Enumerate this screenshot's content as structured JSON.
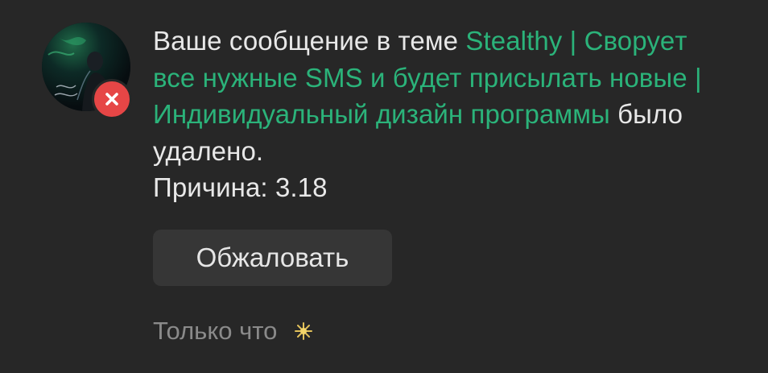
{
  "notification": {
    "avatar_icon": "user-avatar",
    "badge_icon": "close-icon",
    "message": {
      "prefix": "Ваше сообщение в теме ",
      "thread_title": "Stealthy | Своруeт все нужные SMS и будет присылать новые | Индивидуальный дизайн программы",
      "suffix": " было удалено.",
      "reason": "Причина: 3.18"
    },
    "appeal_button_label": "Обжаловать",
    "timestamp": "Только что",
    "new_indicator_icon": "sparkle-icon"
  },
  "colors": {
    "background": "#272727",
    "text": "#e8e8e8",
    "link": "#2bb37a",
    "badge": "#e64646",
    "button": "#363636",
    "muted": "#8a8a8a"
  }
}
